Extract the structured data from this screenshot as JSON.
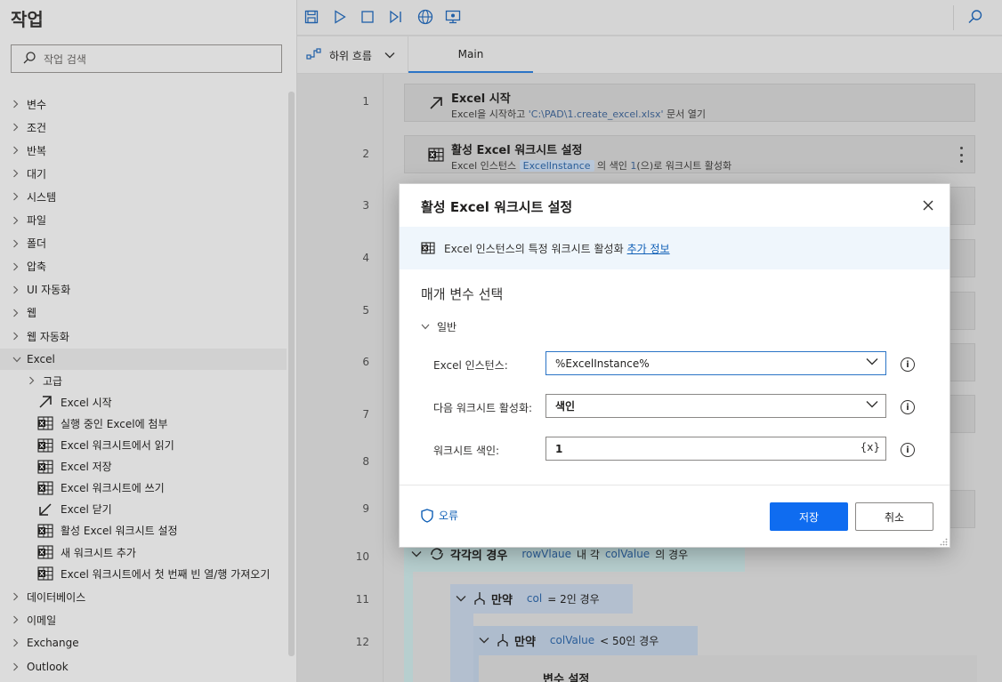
{
  "actions_pane": {
    "title": "작업",
    "search_placeholder": "작업 검색",
    "categories_top": [
      "변수",
      "조건",
      "반복",
      "대기",
      "시스템",
      "파일",
      "폴더",
      "압축",
      "UI 자동화",
      "웹",
      "웹 자동화"
    ],
    "excel_category": "Excel",
    "excel_sub": "고급",
    "excel_actions": [
      {
        "label": "Excel 시작",
        "icon": "arrow-up-right-icon"
      },
      {
        "label": "실행 중인 Excel에 첨부",
        "icon": "excel-grid-icon"
      },
      {
        "label": "Excel 워크시트에서 읽기",
        "icon": "excel-grid-icon"
      },
      {
        "label": "Excel 저장",
        "icon": "excel-grid-icon"
      },
      {
        "label": "Excel 워크시트에 쓰기",
        "icon": "excel-grid-icon"
      },
      {
        "label": "Excel 닫기",
        "icon": "arrow-down-left-icon"
      },
      {
        "label": "활성 Excel 워크시트 설정",
        "icon": "excel-grid-icon"
      },
      {
        "label": "새 워크시트 추가",
        "icon": "excel-grid-icon"
      },
      {
        "label": "Excel 워크시트에서 첫 번째 빈 열/행 가져오기",
        "icon": "excel-grid-icon"
      }
    ],
    "categories_bottom": [
      "데이터베이스",
      "이메일",
      "Exchange",
      "Outlook"
    ]
  },
  "tabbar": {
    "subflows_label": "하위 흐름",
    "main_tab": "Main"
  },
  "line_numbers": [
    "1",
    "2",
    "3",
    "4",
    "5",
    "6",
    "7",
    "8",
    "9",
    "10",
    "11",
    "12"
  ],
  "flow": {
    "step1": {
      "title": "Excel 시작",
      "desc_pre": "Excel을 시작하고 ",
      "desc_path": "'C:\\PAD\\1.create_excel.xlsx'",
      "desc_post": " 문서 열기"
    },
    "step2": {
      "title": "활성 Excel 워크시트 설정",
      "desc_pre": "Excel 인스턴스 ",
      "desc_var": "ExcelInstance",
      "desc_mid": " 의 색인 ",
      "desc_num": "1",
      "desc_post": "(으)로 워크시트 활성화"
    },
    "loop10": {
      "keyword": "각각의 경우",
      "var1": "rowVlaue",
      "mid": "내 각",
      "var2": "colValue",
      "post": "의 경우"
    },
    "if11": {
      "keyword": "만약",
      "var": "col",
      "post": "= 2인 경우"
    },
    "if12": {
      "keyword": "만약",
      "var": "colValue",
      "post": "< 50인 경우"
    },
    "step13_partial": "변수 설정"
  },
  "dialog": {
    "title": "활성 Excel 워크시트 설정",
    "info_text": "Excel 인스턴스의 특정 워크시트 활성화",
    "info_link": "추가 정보",
    "params_title": "매개 변수 선택",
    "section": "일반",
    "fields": [
      {
        "label": "Excel 인스턴스:",
        "value": "%ExcelInstance%"
      },
      {
        "label": "다음 워크시트 활성화:",
        "value": "색인"
      },
      {
        "label": "워크시트 색인:",
        "value": "1",
        "var_button": "{x}"
      }
    ],
    "error_label": "오류",
    "save_label": "저장",
    "cancel_label": "취소"
  }
}
